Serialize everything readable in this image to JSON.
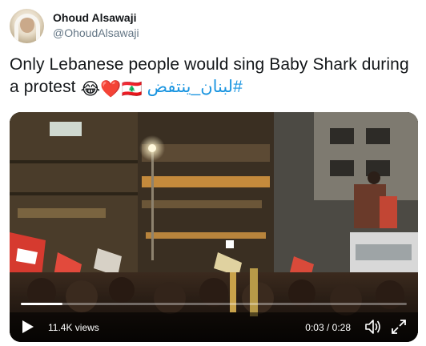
{
  "author": {
    "display_name": "Ohoud Alsawaji",
    "handle": "@OhoudAlsawaji"
  },
  "tweet": {
    "text_part": "Only Lebanese people would sing Baby Shark during a protest ",
    "emojis": "😂❤️🇱🇧",
    "hashtag": "#لبنان_ينتفض"
  },
  "video": {
    "views": "11.4K views",
    "time": "0:03 / 0:28",
    "progress_fraction": 0.107
  },
  "colors": {
    "hashtag": "#1b95e0",
    "handle": "#657786"
  },
  "icons": {
    "play": "play-icon",
    "volume": "volume-icon",
    "fullscreen": "fullscreen-icon"
  }
}
